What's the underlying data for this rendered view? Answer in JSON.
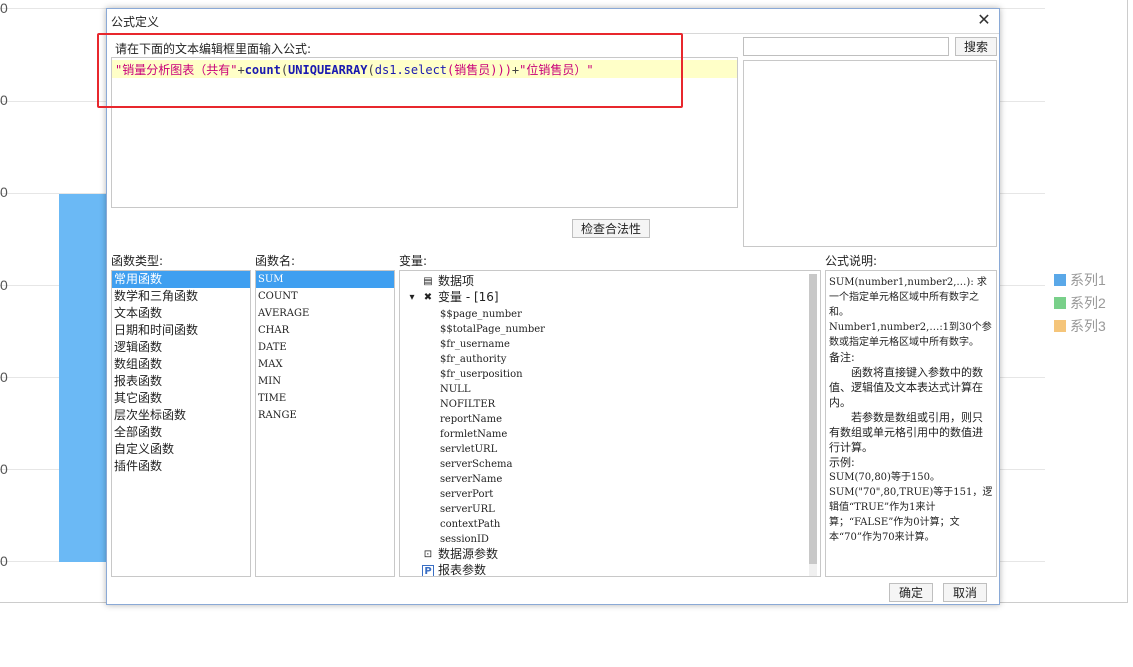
{
  "background_chart": {
    "y_ticks": [
      "0",
      "0",
      "0",
      "0",
      "0",
      "0",
      "0"
    ],
    "legend": [
      {
        "label": "系列1",
        "color": "#5aa8e8"
      },
      {
        "label": "系列2",
        "color": "#79d08a"
      },
      {
        "label": "系列3",
        "color": "#f5c57a"
      }
    ]
  },
  "dialog": {
    "title": "公式定义",
    "prompt": "请在下面的文本编辑框里面输入公式:",
    "formula_parts": {
      "p1": "\"销量分析图表（共有\"",
      "p2": "+",
      "p3": "count",
      "p4": "(",
      "p5": "UNIQUEARRAY",
      "p6": "(",
      "p7": "ds1.select",
      "p8": "(销售员)))",
      "p9": "+",
      "p10": "\"位销售员）\""
    },
    "check_button": "检查合法性",
    "search_button": "搜索",
    "search_placeholder": "",
    "labels": {
      "categories": "函数类型:",
      "functions": "函数名:",
      "variables": "变量:",
      "description": "公式说明:"
    },
    "categories": [
      "常用函数",
      "数学和三角函数",
      "文本函数",
      "日期和时间函数",
      "逻辑函数",
      "数组函数",
      "报表函数",
      "其它函数",
      "层次坐标函数",
      "全部函数",
      "自定义函数",
      "插件函数"
    ],
    "functions": [
      "SUM",
      "COUNT",
      "AVERAGE",
      "CHAR",
      "DATE",
      "MAX",
      "MIN",
      "TIME",
      "RANGE"
    ],
    "variables_tree": {
      "data_item": "数据项",
      "var_group": "变量 - [16]",
      "vars": [
        "$$page_number",
        "$$totalPage_number",
        "$fr_username",
        "$fr_authority",
        "$fr_userposition",
        "NULL",
        "NOFILTER",
        "reportName",
        "formletName",
        "servletURL",
        "serverSchema",
        "serverName",
        "serverPort",
        "serverURL",
        "contextPath",
        "sessionID"
      ],
      "ds_params": "数据源参数",
      "report_params": "报表参数"
    },
    "description": {
      "l1": "SUM(number1,number2,…): 求一个指定单元格区域中所有数字之和。",
      "l2": "Number1,number2,…:1到30个参数或指定单元格区域中所有数字。",
      "l3": "备注:",
      "l4": "函数将直接键入参数中的数值、逻辑值及文本表达式计算在内。",
      "l5": "若参数是数组或引用，则只有数组或单元格引用中的数值进行计算。",
      "l6": "示例:",
      "l7": "SUM(70,80)等于150。",
      "l8": "SUM(\"70\",80,TRUE)等于151，逻辑值“TRUE”作为1来计算；“FALSE”作为0计算；文本“70”作为70来计算。"
    },
    "ok_button": "确定",
    "cancel_button": "取消"
  }
}
